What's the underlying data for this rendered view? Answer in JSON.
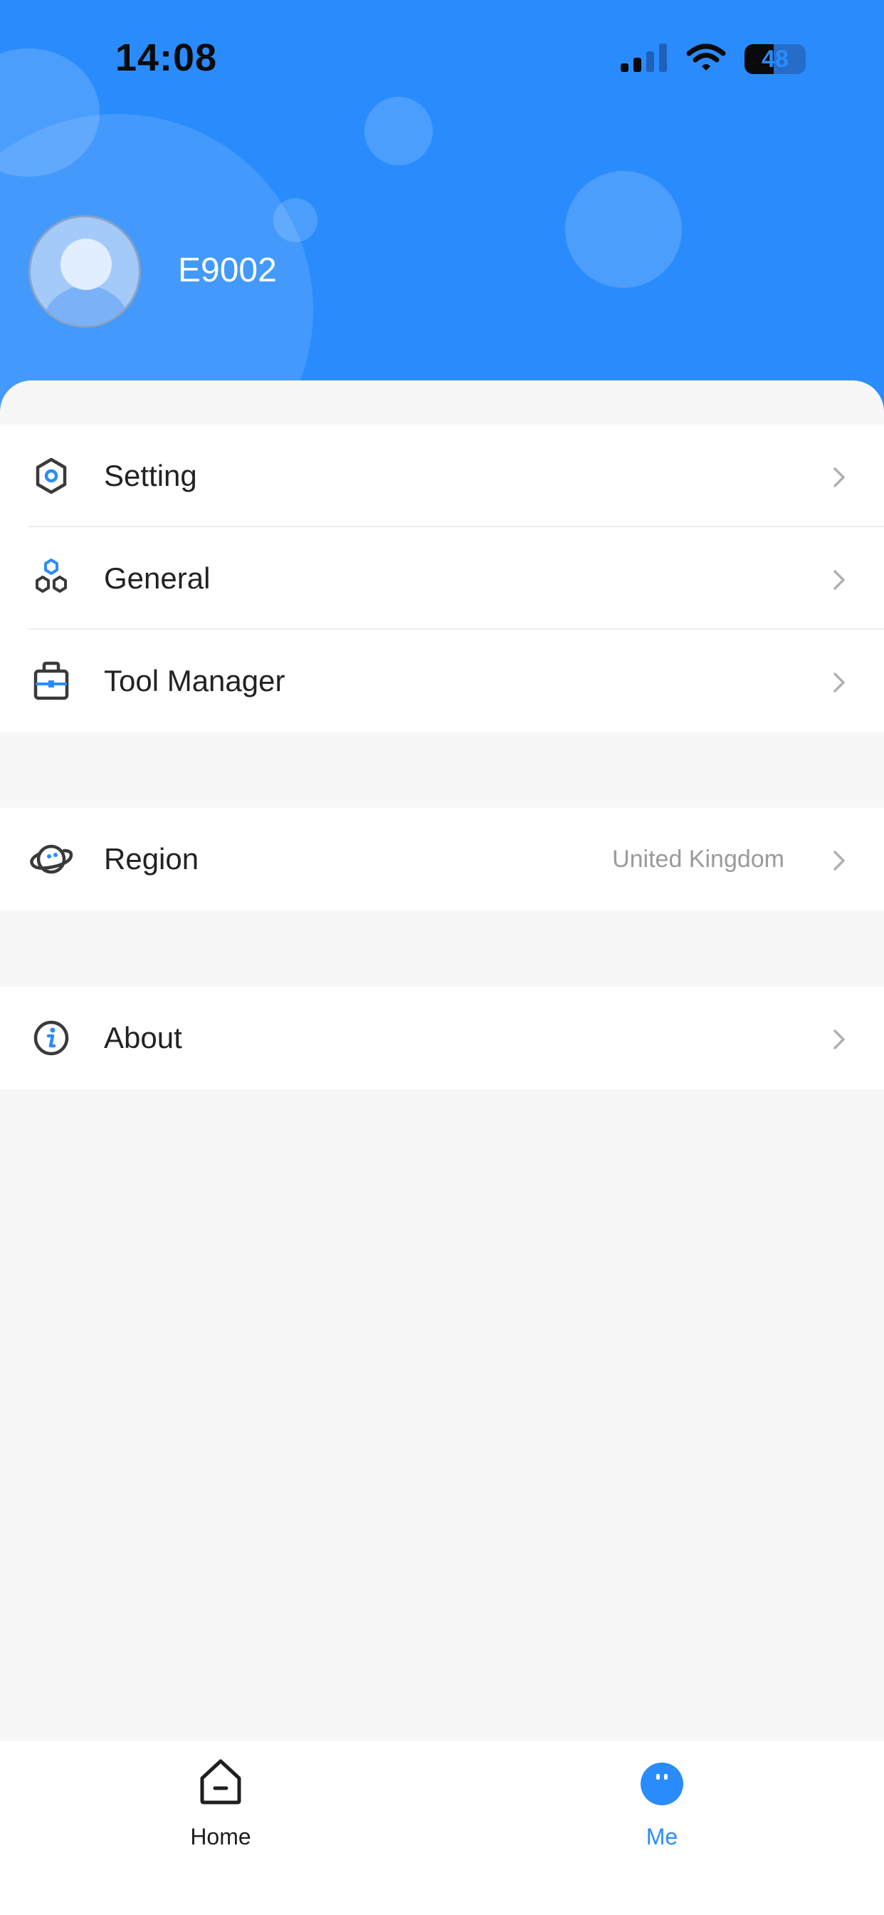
{
  "status_bar": {
    "time": "14:08",
    "battery_level": "48",
    "signal_icon": "cellular-signal-icon",
    "wifi_icon": "wifi-icon",
    "battery_icon": "battery-icon"
  },
  "profile": {
    "avatar_icon": "avatar-placeholder-icon",
    "username": "E9002"
  },
  "menu": {
    "group1": [
      {
        "label": "Setting",
        "icon": "hexagon-gear-icon"
      },
      {
        "label": "General",
        "icon": "hexagons-cluster-icon"
      },
      {
        "label": "Tool Manager",
        "icon": "toolbox-icon"
      }
    ],
    "region": {
      "label": "Region",
      "value": "United Kingdom",
      "icon": "planet-icon"
    },
    "about": {
      "label": "About",
      "icon": "info-icon"
    }
  },
  "tabbar": {
    "home": {
      "label": "Home",
      "icon": "home-icon",
      "active": false
    },
    "me": {
      "label": "Me",
      "icon": "me-face-icon",
      "active": true
    }
  },
  "colors": {
    "header_blue": "#2a8cfc",
    "accent": "#2a8cfc",
    "text_primary": "#222222",
    "text_secondary": "#9a9a9a",
    "background": "#f7f7f7"
  }
}
